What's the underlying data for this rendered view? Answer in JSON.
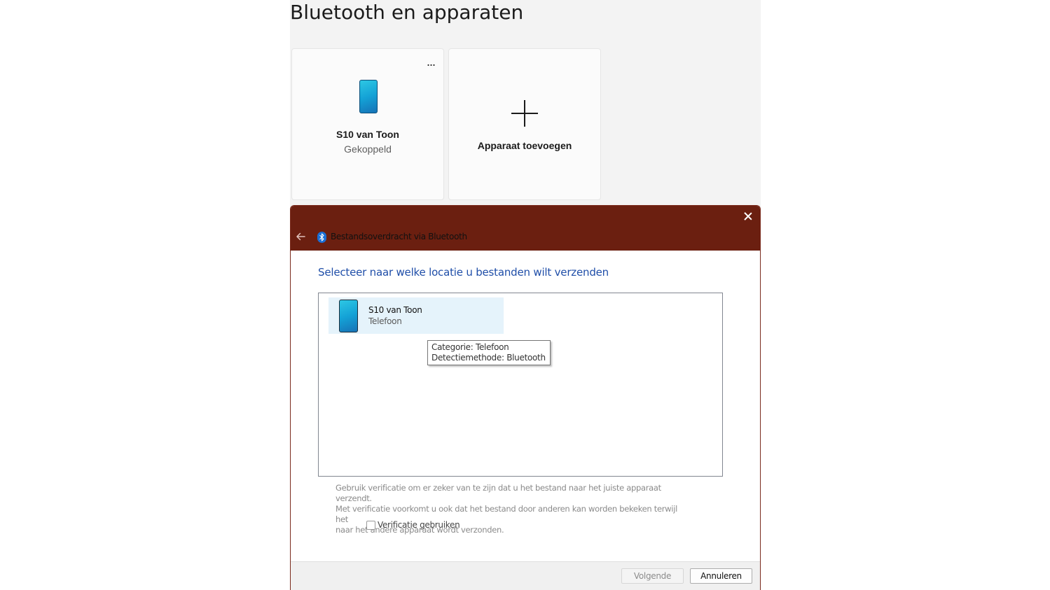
{
  "settings": {
    "title": "Bluetooth en apparaten",
    "device_card": {
      "name": "S10 van Toon",
      "status": "Gekoppeld",
      "more_label": "..."
    },
    "add_card": {
      "label": "Apparaat toevoegen"
    }
  },
  "dialog": {
    "title": "Bestandsoverdracht via Bluetooth",
    "accent_color": "#6b1f10",
    "instruction": "Selecteer naar welke locatie u bestanden wilt verzenden",
    "devices": [
      {
        "name": "S10 van Toon",
        "type": "Telefoon",
        "selected": true
      }
    ],
    "tooltip": {
      "line1": "Categorie: Telefoon",
      "line2": "Detectiemethode: Bluetooth"
    },
    "verification_text": {
      "line1": "Gebruik verificatie om er zeker van te zijn dat u het bestand naar het juiste apparaat verzendt.",
      "line2": "Met verificatie voorkomt u ook dat het bestand door anderen kan worden bekeken terwijl het",
      "line3": "naar het andere apparaat wordt verzonden."
    },
    "checkbox_label": "Verificatie gebruiken",
    "checkbox_checked": false,
    "next_label": "Volgende",
    "cancel_label": "Annuleren"
  }
}
